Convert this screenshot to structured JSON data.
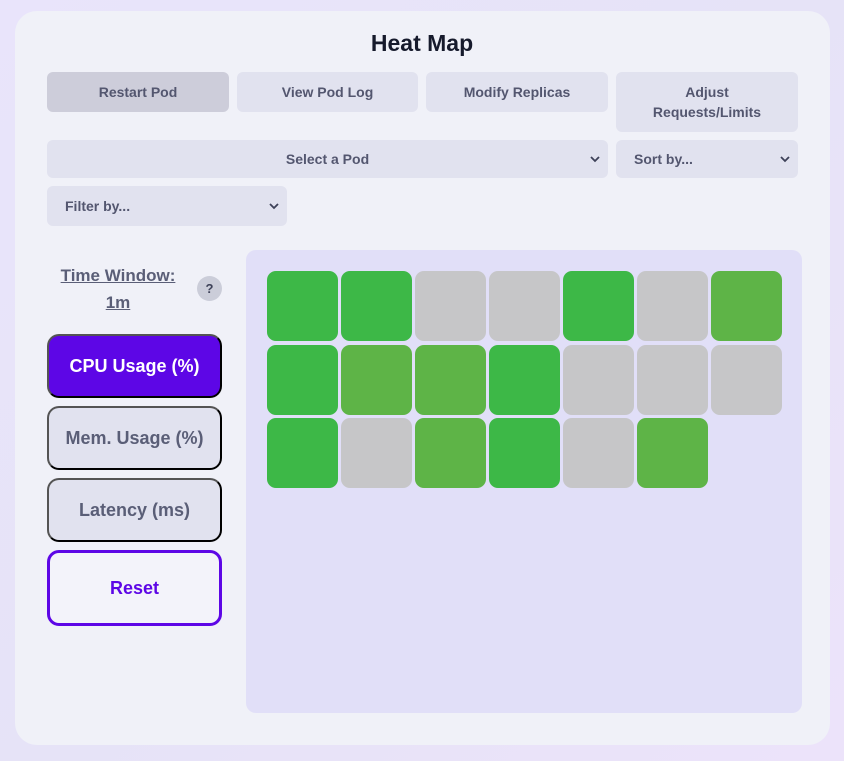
{
  "title": "Heat Map",
  "actions": [
    {
      "label": "Restart Pod",
      "active": true
    },
    {
      "label": "View Pod Log",
      "active": false
    },
    {
      "label": "Modify Replicas",
      "active": false
    },
    {
      "label": "Adjust Requests/Limits",
      "active": false
    }
  ],
  "pod_select": {
    "value": "Select a Pod"
  },
  "sort_select": {
    "value": "Sort by..."
  },
  "filter_select": {
    "value": "Filter by..."
  },
  "time_window": {
    "label": "Time Window: 1m",
    "help": "?"
  },
  "metrics": [
    {
      "label": "CPU Usage (%)",
      "active": true
    },
    {
      "label": "Mem. Usage (%)",
      "active": false
    },
    {
      "label": "Latency (ms)",
      "active": false
    }
  ],
  "reset_label": "Reset",
  "colors": {
    "accent": "#5d06e6",
    "high": "#3db847",
    "mid": "#5eb447",
    "none": "#c6c6c8"
  },
  "heatmap": {
    "columns": 7,
    "cells": [
      "high",
      "high",
      "none",
      "none",
      "high",
      "none",
      "mid",
      "high",
      "mid",
      "mid",
      "high",
      "none",
      "none",
      "none",
      "high",
      "none",
      "mid",
      "high",
      "none",
      "mid"
    ]
  }
}
